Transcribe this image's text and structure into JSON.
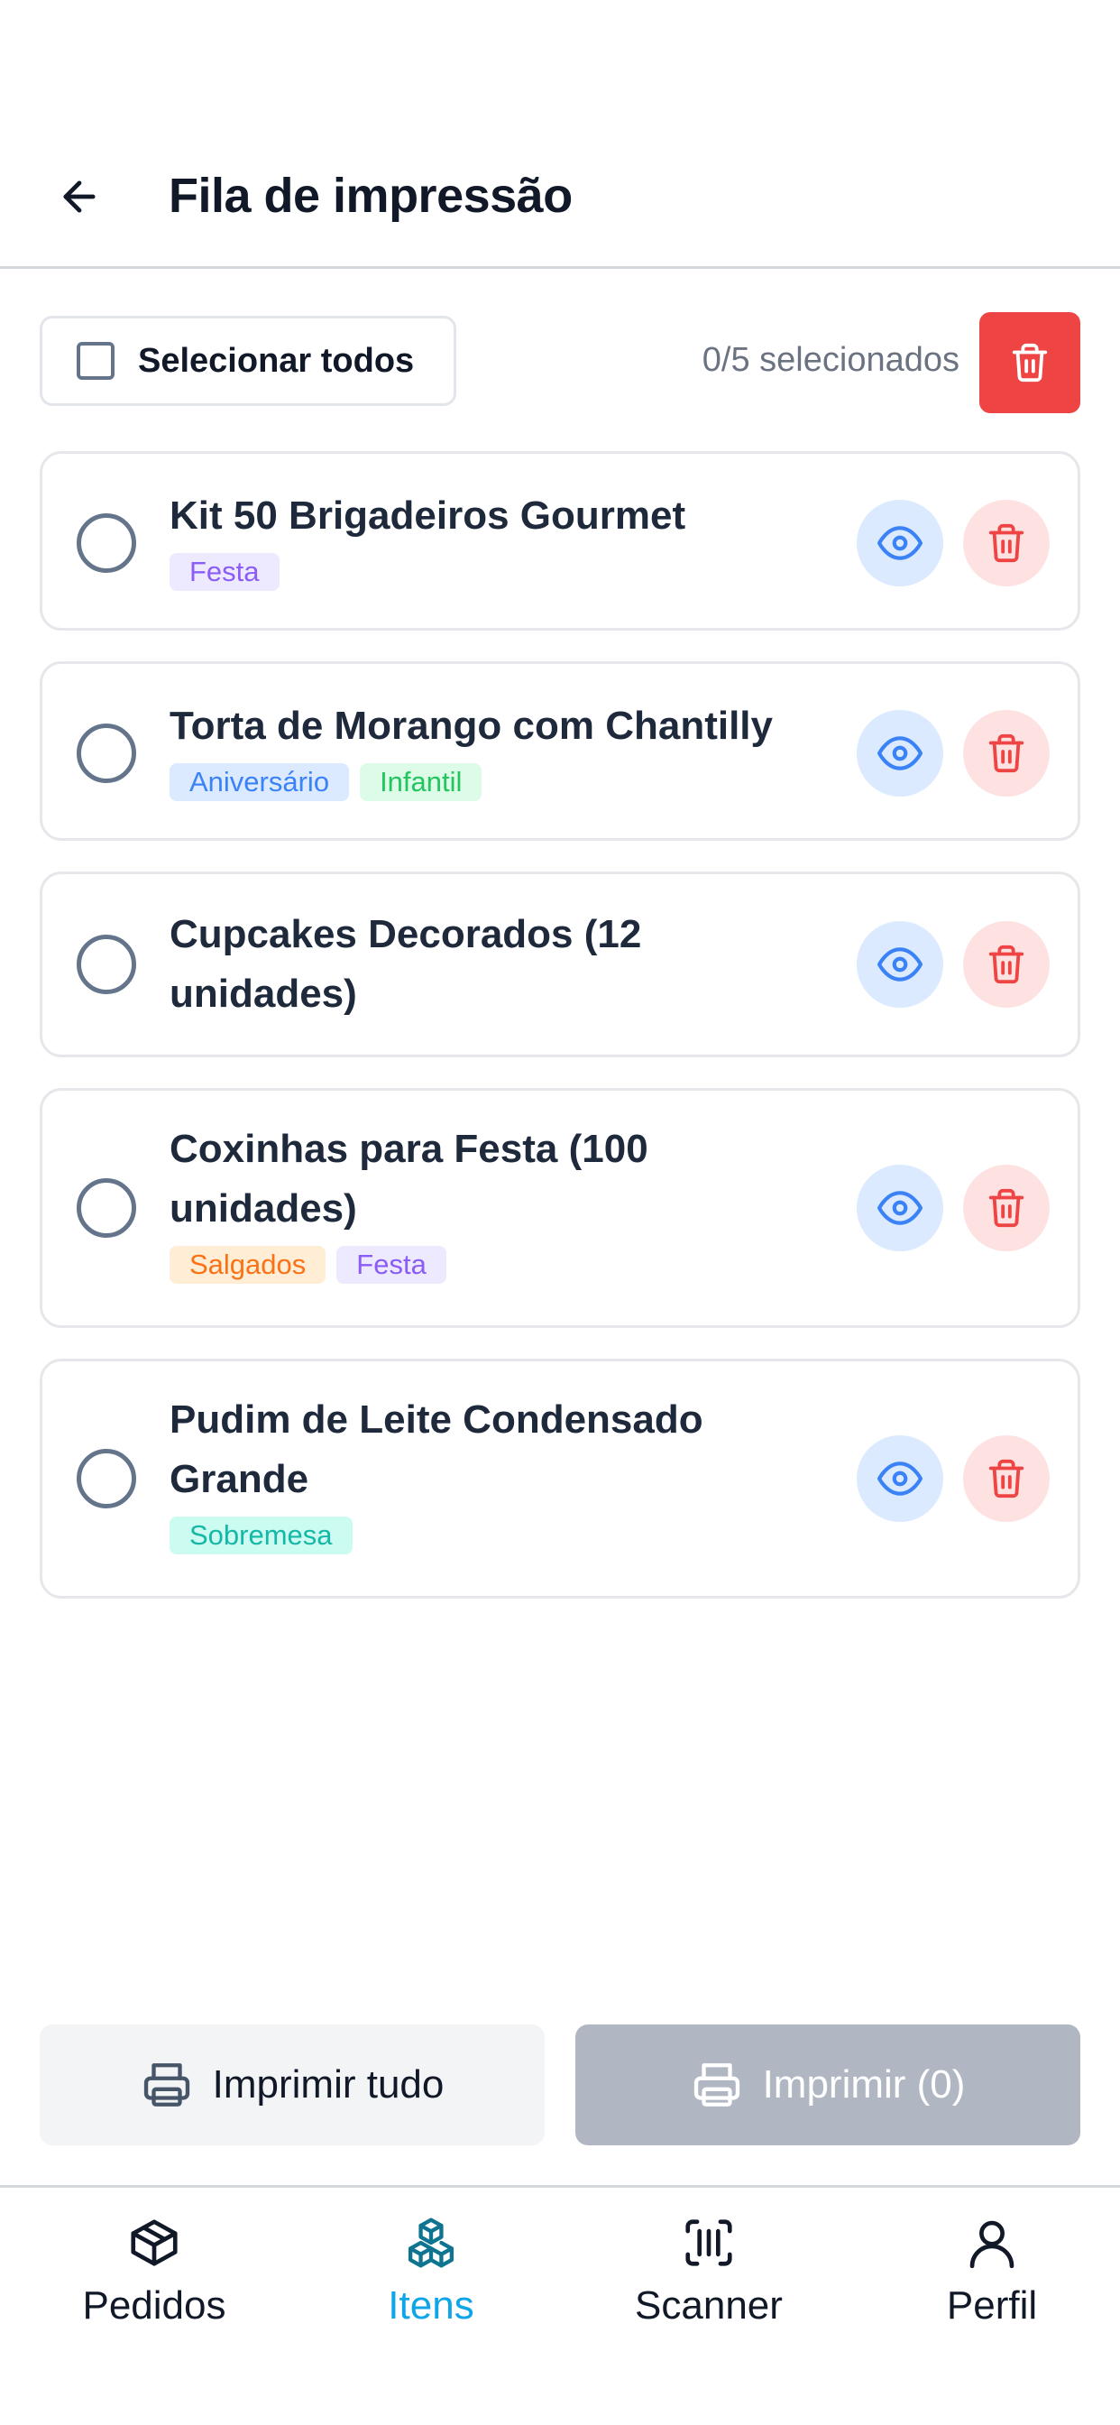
{
  "header": {
    "title": "Fila de impressão"
  },
  "toolbar": {
    "select_all_label": "Selecionar todos",
    "selected_count": "0/5 selecionados"
  },
  "items": [
    {
      "title": "Kit 50 Brigadeiros Gourmet",
      "tags": [
        "Festa"
      ]
    },
    {
      "title": "Torta de Morango com Chantilly",
      "tags": [
        "Aniversário",
        "Infantil"
      ]
    },
    {
      "title": "Cupcakes Decorados (12 unidades)",
      "tags": []
    },
    {
      "title": "Coxinhas para Festa (100 unidades)",
      "tags": [
        "Salgados",
        "Festa"
      ]
    },
    {
      "title": "Pudim de Leite Condensado Grande",
      "tags": [
        "Sobremesa"
      ]
    }
  ],
  "actions": {
    "print_all_label": "Imprimir tudo",
    "print_selected_label": "Imprimir (0)"
  },
  "tabbar": {
    "items": [
      {
        "label": "Pedidos",
        "icon": "box-icon"
      },
      {
        "label": "Itens",
        "icon": "cubes-icon",
        "active": true
      },
      {
        "label": "Scanner",
        "icon": "scan-barcode-icon"
      },
      {
        "label": "Perfil",
        "icon": "user-icon"
      }
    ]
  },
  "colors": {
    "danger": "#ef4444",
    "accent": "#0ea5e9",
    "view": "#3b82f6",
    "disabled": "#b0b7c3"
  }
}
